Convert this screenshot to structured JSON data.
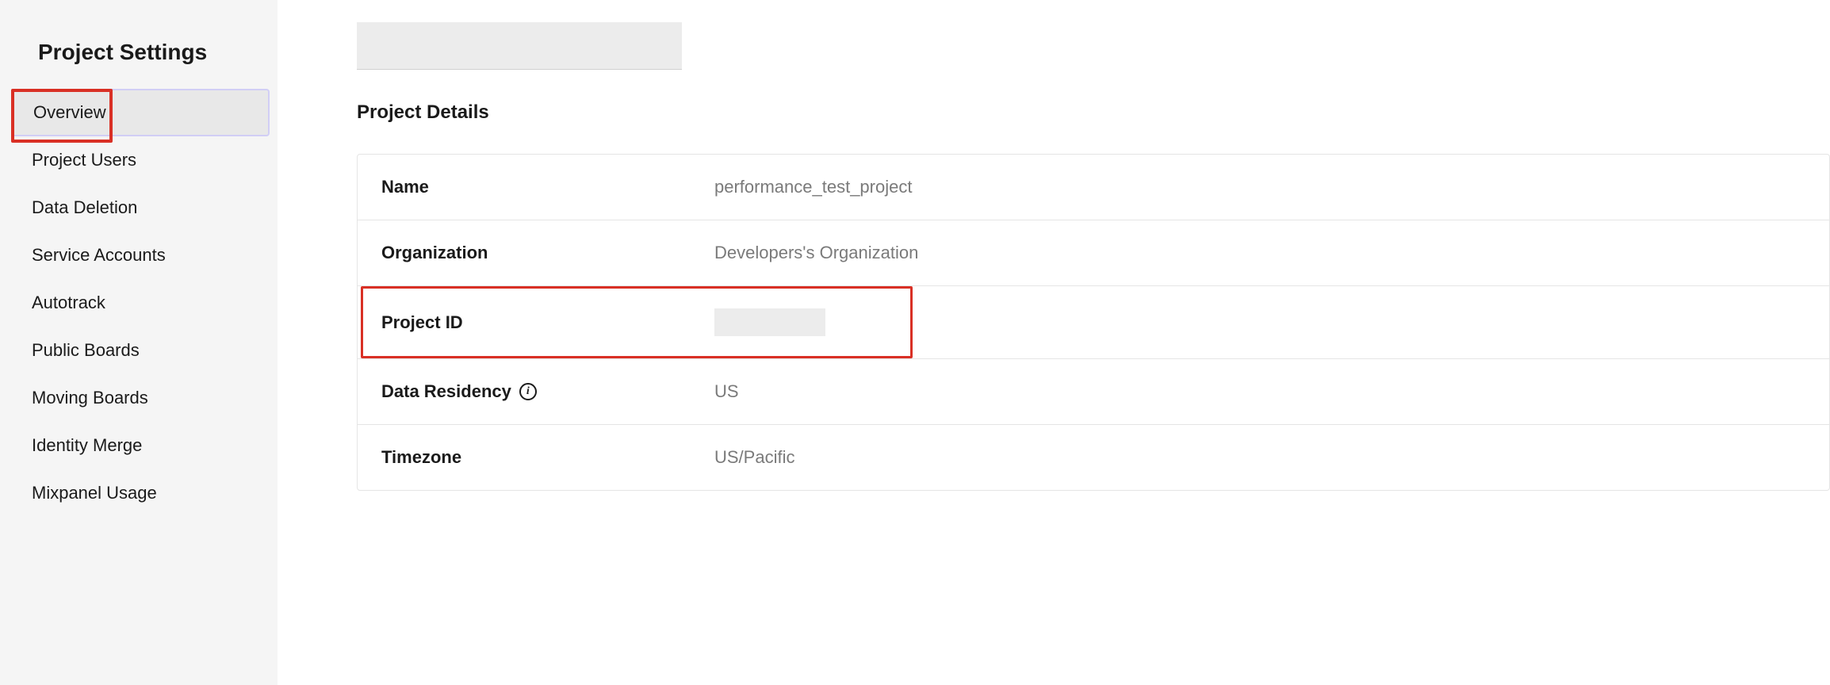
{
  "sidebar": {
    "title": "Project Settings",
    "items": [
      {
        "label": "Overview"
      },
      {
        "label": "Project Users"
      },
      {
        "label": "Data Deletion"
      },
      {
        "label": "Service Accounts"
      },
      {
        "label": "Autotrack"
      },
      {
        "label": "Public Boards"
      },
      {
        "label": "Moving Boards"
      },
      {
        "label": "Identity Merge"
      },
      {
        "label": "Mixpanel Usage"
      }
    ]
  },
  "main": {
    "sectionTitle": "Project Details",
    "rows": {
      "name": {
        "label": "Name",
        "value": "performance_test_project"
      },
      "organization": {
        "label": "Organization",
        "value": "Developers's Organization"
      },
      "projectId": {
        "label": "Project ID",
        "value": ""
      },
      "dataResidency": {
        "label": "Data Residency",
        "value": "US"
      },
      "timezone": {
        "label": "Timezone",
        "value": "US/Pacific"
      }
    }
  },
  "icons": {
    "info": "i"
  }
}
